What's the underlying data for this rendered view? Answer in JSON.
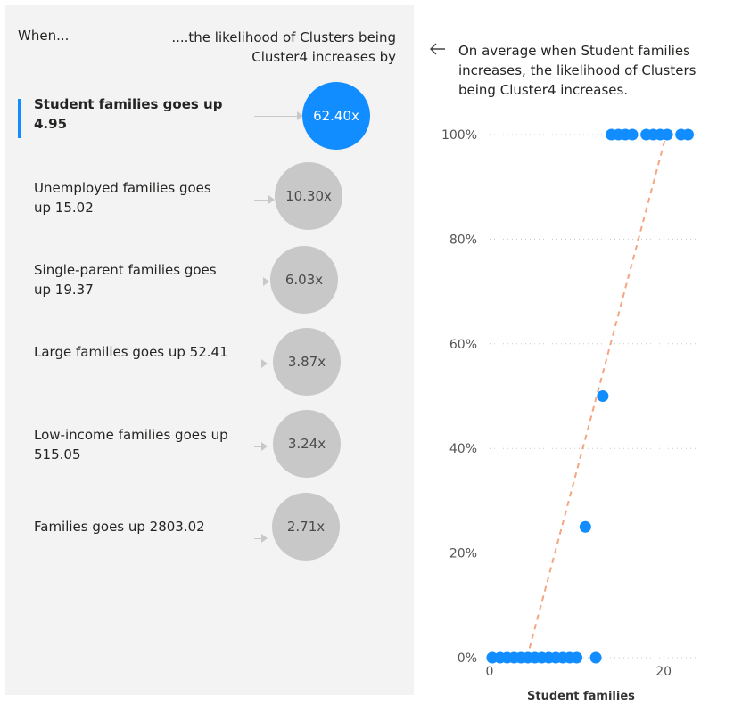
{
  "key_influencers": {
    "header_when": "When...",
    "header_likelihood": "....the likelihood of Clusters being Cluster4 increases by",
    "items": [
      {
        "label": "Student families goes up 4.95",
        "factor": "62.40x",
        "selected": true
      },
      {
        "label": "Unemployed families goes up 15.02",
        "factor": "10.30x",
        "selected": false
      },
      {
        "label": "Single-parent families goes up 19.37",
        "factor": "6.03x",
        "selected": false
      },
      {
        "label": "Large families goes up 52.41",
        "factor": "3.87x",
        "selected": false
      },
      {
        "label": "Low-income families goes up 515.05",
        "factor": "3.24x",
        "selected": false
      },
      {
        "label": "Families goes up 2803.02",
        "factor": "2.71x",
        "selected": false
      }
    ]
  },
  "detail": {
    "back_icon": "arrow-left-icon",
    "description": "On average when Student families increases, the likelihood of Clusters being Cluster4 increases."
  },
  "colors": {
    "accent": "#118dff",
    "neutral_bubble": "#c8c8c8",
    "trend_line": "#f4a582",
    "panel_bg": "#f3f3f3"
  },
  "chart_data": {
    "type": "scatter",
    "xlabel": "Student families",
    "ylabel": "",
    "xlim": [
      0,
      29
    ],
    "ylim": [
      0,
      100
    ],
    "x_ticks": [
      "0",
      "20"
    ],
    "y_ticks": [
      "0%",
      "20%",
      "40%",
      "60%",
      "80%",
      "100%"
    ],
    "grid": true,
    "series": [
      {
        "points": [
          {
            "x": 0.3,
            "y": 0
          },
          {
            "x": 1.2,
            "y": 0
          },
          {
            "x": 2.0,
            "y": 0
          },
          {
            "x": 2.8,
            "y": 0
          },
          {
            "x": 3.6,
            "y": 0
          },
          {
            "x": 4.4,
            "y": 0
          },
          {
            "x": 5.2,
            "y": 0
          },
          {
            "x": 6.0,
            "y": 0
          },
          {
            "x": 6.8,
            "y": 0
          },
          {
            "x": 7.6,
            "y": 0
          },
          {
            "x": 8.4,
            "y": 0
          },
          {
            "x": 9.2,
            "y": 0
          },
          {
            "x": 10.0,
            "y": 0
          },
          {
            "x": 12.2,
            "y": 0
          },
          {
            "x": 11.0,
            "y": 25
          },
          {
            "x": 13.0,
            "y": 50
          },
          {
            "x": 14.0,
            "y": 100
          },
          {
            "x": 14.8,
            "y": 100
          },
          {
            "x": 15.6,
            "y": 100
          },
          {
            "x": 16.4,
            "y": 100
          },
          {
            "x": 18.0,
            "y": 100
          },
          {
            "x": 18.8,
            "y": 100
          },
          {
            "x": 19.6,
            "y": 100
          },
          {
            "x": 20.4,
            "y": 100
          },
          {
            "x": 22.0,
            "y": 100
          },
          {
            "x": 22.8,
            "y": 100
          }
        ]
      }
    ],
    "trend_line": {
      "x0": 4.3,
      "y0": 0,
      "x1": 20.3,
      "y1": 100
    }
  }
}
